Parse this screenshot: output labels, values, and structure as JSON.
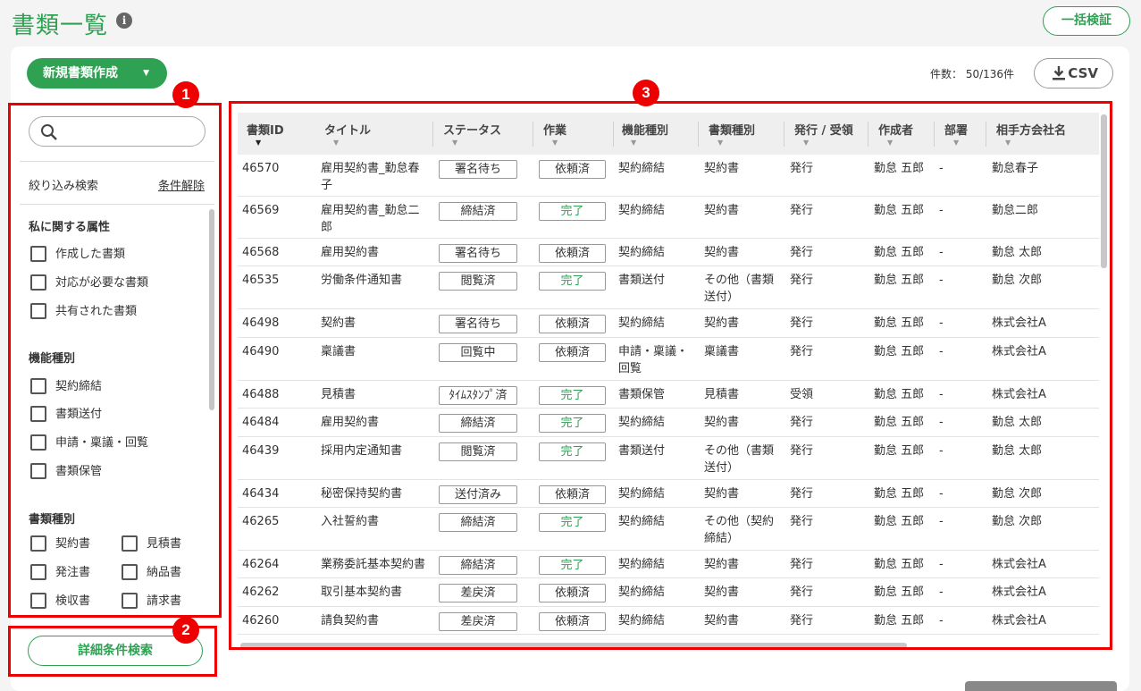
{
  "header": {
    "title": "書類一覧",
    "info_icon": "i",
    "bulk_verify_label": "一括検証"
  },
  "toolbar": {
    "new_doc_label": "新規書類作成",
    "new_doc_caret": "▼",
    "count_text": "件数： 50/136件",
    "csv_label": "CSV"
  },
  "filter": {
    "search_placeholder": "",
    "narrow_label": "絞り込み検索",
    "clear_label": "条件解除",
    "sections": {
      "mine": {
        "title": "私に関する属性",
        "items": [
          "作成した書類",
          "対応が必要な書類",
          "共有された書類"
        ]
      },
      "func": {
        "title": "機能種別",
        "items": [
          "契約締結",
          "書類送付",
          "申請・稟議・回覧",
          "書類保管"
        ]
      },
      "doc": {
        "title": "書類種別",
        "items": [
          "契約書",
          "見積書",
          "発注書",
          "納品書",
          "検収書",
          "請求書"
        ]
      }
    },
    "advanced_label": "詳細条件検索"
  },
  "badges": [
    "1",
    "2",
    "3"
  ],
  "table": {
    "headers": [
      "書類ID",
      "タイトル",
      "ステータス",
      "作業",
      "機能種別",
      "書類種別",
      "発行 / 受領",
      "作成者",
      "部署",
      "相手方会社名"
    ],
    "sort_icon": "▼",
    "rows": [
      {
        "id": "46570",
        "title": "雇用契約書_勤怠春",
        "title2": "子",
        "status": "署名待ち",
        "work": "依頼済",
        "func": "契約締結",
        "doctype": "契約書",
        "doctype2": "",
        "issue": "発行",
        "author": "勤怠 五郎",
        "dept": "-",
        "partner": "勤怠春子"
      },
      {
        "id": "46569",
        "title": "雇用契約書_勤怠二",
        "title2": "郎",
        "status": "締結済",
        "work": "完了",
        "func": "契約締結",
        "doctype": "契約書",
        "doctype2": "",
        "issue": "発行",
        "author": "勤怠 五郎",
        "dept": "-",
        "partner": "勤怠二郎"
      },
      {
        "id": "46568",
        "title": "雇用契約書",
        "title2": "",
        "status": "署名待ち",
        "work": "依頼済",
        "func": "契約締結",
        "doctype": "契約書",
        "doctype2": "",
        "issue": "発行",
        "author": "勤怠 五郎",
        "dept": "-",
        "partner": "勤怠 太郎"
      },
      {
        "id": "46535",
        "title": "労働条件通知書",
        "title2": "",
        "status": "閲覧済",
        "work": "完了",
        "func": "書類送付",
        "doctype": "その他（書類",
        "doctype2": "送付）",
        "issue": "発行",
        "author": "勤怠 五郎",
        "dept": "-",
        "partner": "勤怠 次郎"
      },
      {
        "id": "46498",
        "title": "契約書",
        "title2": "",
        "status": "署名待ち",
        "work": "依頼済",
        "func": "契約締結",
        "doctype": "契約書",
        "doctype2": "",
        "issue": "発行",
        "author": "勤怠 五郎",
        "dept": "-",
        "partner": "株式会社A"
      },
      {
        "id": "46490",
        "title": "稟議書",
        "title2": "",
        "status": "回覧中",
        "work": "依頼済",
        "func": "申請・稟議・",
        "func2": "回覧",
        "doctype": "稟議書",
        "doctype2": "",
        "issue": "発行",
        "author": "勤怠 五郎",
        "dept": "-",
        "partner": "株式会社A"
      },
      {
        "id": "46488",
        "title": "見積書",
        "title2": "",
        "status": "ﾀｲﾑｽﾀﾝﾌﾟ済",
        "work": "完了",
        "func": "書類保管",
        "doctype": "見積書",
        "doctype2": "",
        "issue": "受領",
        "author": "勤怠 五郎",
        "dept": "-",
        "partner": "株式会社A"
      },
      {
        "id": "46484",
        "title": "雇用契約書",
        "title2": "",
        "status": "締結済",
        "work": "完了",
        "func": "契約締結",
        "doctype": "契約書",
        "doctype2": "",
        "issue": "発行",
        "author": "勤怠 五郎",
        "dept": "-",
        "partner": "勤怠 太郎"
      },
      {
        "id": "46439",
        "title": "採用内定通知書",
        "title2": "",
        "status": "閲覧済",
        "work": "完了",
        "func": "書類送付",
        "doctype": "その他（書類",
        "doctype2": "送付）",
        "issue": "発行",
        "author": "勤怠 五郎",
        "dept": "-",
        "partner": "勤怠 太郎"
      },
      {
        "id": "46434",
        "title": "秘密保持契約書",
        "title2": "",
        "status": "送付済み",
        "work": "依頼済",
        "func": "契約締結",
        "doctype": "契約書",
        "doctype2": "",
        "issue": "発行",
        "author": "勤怠 五郎",
        "dept": "-",
        "partner": "勤怠 次郎"
      },
      {
        "id": "46265",
        "title": "入社誓約書",
        "title2": "",
        "status": "締結済",
        "work": "完了",
        "func": "契約締結",
        "doctype": "その他（契約",
        "doctype2": "締結）",
        "issue": "発行",
        "author": "勤怠 五郎",
        "dept": "-",
        "partner": "勤怠 次郎"
      },
      {
        "id": "46264",
        "title": "業務委託基本契約書",
        "title2": "",
        "status": "締結済",
        "work": "完了",
        "func": "契約締結",
        "doctype": "契約書",
        "doctype2": "",
        "issue": "発行",
        "author": "勤怠 五郎",
        "dept": "-",
        "partner": "株式会社A"
      },
      {
        "id": "46262",
        "title": "取引基本契約書",
        "title2": "",
        "status": "差戻済",
        "work": "依頼済",
        "func": "契約締結",
        "doctype": "契約書",
        "doctype2": "",
        "issue": "発行",
        "author": "勤怠 五郎",
        "dept": "-",
        "partner": "株式会社A"
      },
      {
        "id": "46260",
        "title": "請負契約書",
        "title2": "",
        "status": "差戻済",
        "work": "依頼済",
        "func": "契約締結",
        "doctype": "契約書",
        "doctype2": "",
        "issue": "発行",
        "author": "勤怠 五郎",
        "dept": "-",
        "partner": "株式会社A"
      }
    ]
  },
  "colors": {
    "brand": "#2ea152",
    "highlight": "#ee0000"
  }
}
